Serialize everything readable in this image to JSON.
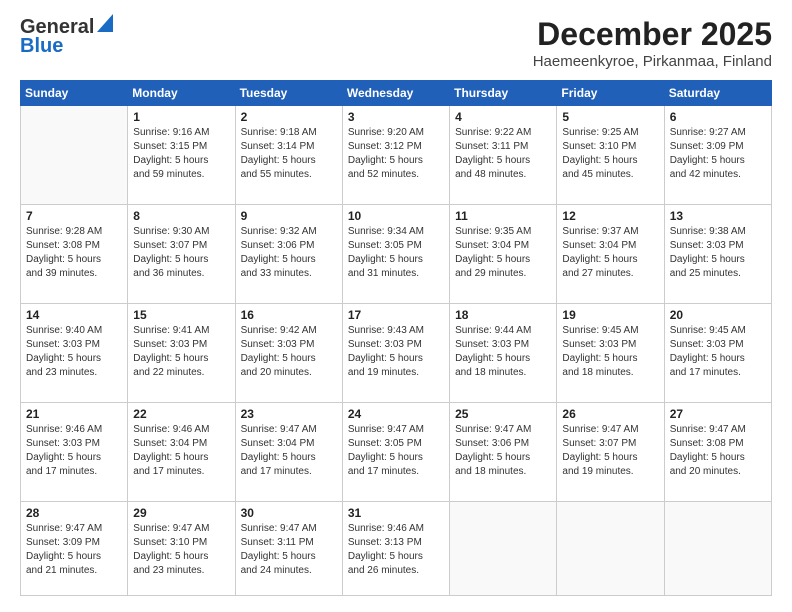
{
  "logo": {
    "line1": "General",
    "line2": "Blue"
  },
  "title": "December 2025",
  "location": "Haemeenkyroe, Pirkanmaa, Finland",
  "weekdays": [
    "Sunday",
    "Monday",
    "Tuesday",
    "Wednesday",
    "Thursday",
    "Friday",
    "Saturday"
  ],
  "weeks": [
    [
      {
        "day": null,
        "info": ""
      },
      {
        "day": "1",
        "info": "Sunrise: 9:16 AM\nSunset: 3:15 PM\nDaylight: 5 hours\nand 59 minutes."
      },
      {
        "day": "2",
        "info": "Sunrise: 9:18 AM\nSunset: 3:14 PM\nDaylight: 5 hours\nand 55 minutes."
      },
      {
        "day": "3",
        "info": "Sunrise: 9:20 AM\nSunset: 3:12 PM\nDaylight: 5 hours\nand 52 minutes."
      },
      {
        "day": "4",
        "info": "Sunrise: 9:22 AM\nSunset: 3:11 PM\nDaylight: 5 hours\nand 48 minutes."
      },
      {
        "day": "5",
        "info": "Sunrise: 9:25 AM\nSunset: 3:10 PM\nDaylight: 5 hours\nand 45 minutes."
      },
      {
        "day": "6",
        "info": "Sunrise: 9:27 AM\nSunset: 3:09 PM\nDaylight: 5 hours\nand 42 minutes."
      }
    ],
    [
      {
        "day": "7",
        "info": "Sunrise: 9:28 AM\nSunset: 3:08 PM\nDaylight: 5 hours\nand 39 minutes."
      },
      {
        "day": "8",
        "info": "Sunrise: 9:30 AM\nSunset: 3:07 PM\nDaylight: 5 hours\nand 36 minutes."
      },
      {
        "day": "9",
        "info": "Sunrise: 9:32 AM\nSunset: 3:06 PM\nDaylight: 5 hours\nand 33 minutes."
      },
      {
        "day": "10",
        "info": "Sunrise: 9:34 AM\nSunset: 3:05 PM\nDaylight: 5 hours\nand 31 minutes."
      },
      {
        "day": "11",
        "info": "Sunrise: 9:35 AM\nSunset: 3:04 PM\nDaylight: 5 hours\nand 29 minutes."
      },
      {
        "day": "12",
        "info": "Sunrise: 9:37 AM\nSunset: 3:04 PM\nDaylight: 5 hours\nand 27 minutes."
      },
      {
        "day": "13",
        "info": "Sunrise: 9:38 AM\nSunset: 3:03 PM\nDaylight: 5 hours\nand 25 minutes."
      }
    ],
    [
      {
        "day": "14",
        "info": "Sunrise: 9:40 AM\nSunset: 3:03 PM\nDaylight: 5 hours\nand 23 minutes."
      },
      {
        "day": "15",
        "info": "Sunrise: 9:41 AM\nSunset: 3:03 PM\nDaylight: 5 hours\nand 22 minutes."
      },
      {
        "day": "16",
        "info": "Sunrise: 9:42 AM\nSunset: 3:03 PM\nDaylight: 5 hours\nand 20 minutes."
      },
      {
        "day": "17",
        "info": "Sunrise: 9:43 AM\nSunset: 3:03 PM\nDaylight: 5 hours\nand 19 minutes."
      },
      {
        "day": "18",
        "info": "Sunrise: 9:44 AM\nSunset: 3:03 PM\nDaylight: 5 hours\nand 18 minutes."
      },
      {
        "day": "19",
        "info": "Sunrise: 9:45 AM\nSunset: 3:03 PM\nDaylight: 5 hours\nand 18 minutes."
      },
      {
        "day": "20",
        "info": "Sunrise: 9:45 AM\nSunset: 3:03 PM\nDaylight: 5 hours\nand 17 minutes."
      }
    ],
    [
      {
        "day": "21",
        "info": "Sunrise: 9:46 AM\nSunset: 3:03 PM\nDaylight: 5 hours\nand 17 minutes."
      },
      {
        "day": "22",
        "info": "Sunrise: 9:46 AM\nSunset: 3:04 PM\nDaylight: 5 hours\nand 17 minutes."
      },
      {
        "day": "23",
        "info": "Sunrise: 9:47 AM\nSunset: 3:04 PM\nDaylight: 5 hours\nand 17 minutes."
      },
      {
        "day": "24",
        "info": "Sunrise: 9:47 AM\nSunset: 3:05 PM\nDaylight: 5 hours\nand 17 minutes."
      },
      {
        "day": "25",
        "info": "Sunrise: 9:47 AM\nSunset: 3:06 PM\nDaylight: 5 hours\nand 18 minutes."
      },
      {
        "day": "26",
        "info": "Sunrise: 9:47 AM\nSunset: 3:07 PM\nDaylight: 5 hours\nand 19 minutes."
      },
      {
        "day": "27",
        "info": "Sunrise: 9:47 AM\nSunset: 3:08 PM\nDaylight: 5 hours\nand 20 minutes."
      }
    ],
    [
      {
        "day": "28",
        "info": "Sunrise: 9:47 AM\nSunset: 3:09 PM\nDaylight: 5 hours\nand 21 minutes."
      },
      {
        "day": "29",
        "info": "Sunrise: 9:47 AM\nSunset: 3:10 PM\nDaylight: 5 hours\nand 23 minutes."
      },
      {
        "day": "30",
        "info": "Sunrise: 9:47 AM\nSunset: 3:11 PM\nDaylight: 5 hours\nand 24 minutes."
      },
      {
        "day": "31",
        "info": "Sunrise: 9:46 AM\nSunset: 3:13 PM\nDaylight: 5 hours\nand 26 minutes."
      },
      {
        "day": null,
        "info": ""
      },
      {
        "day": null,
        "info": ""
      },
      {
        "day": null,
        "info": ""
      }
    ]
  ]
}
